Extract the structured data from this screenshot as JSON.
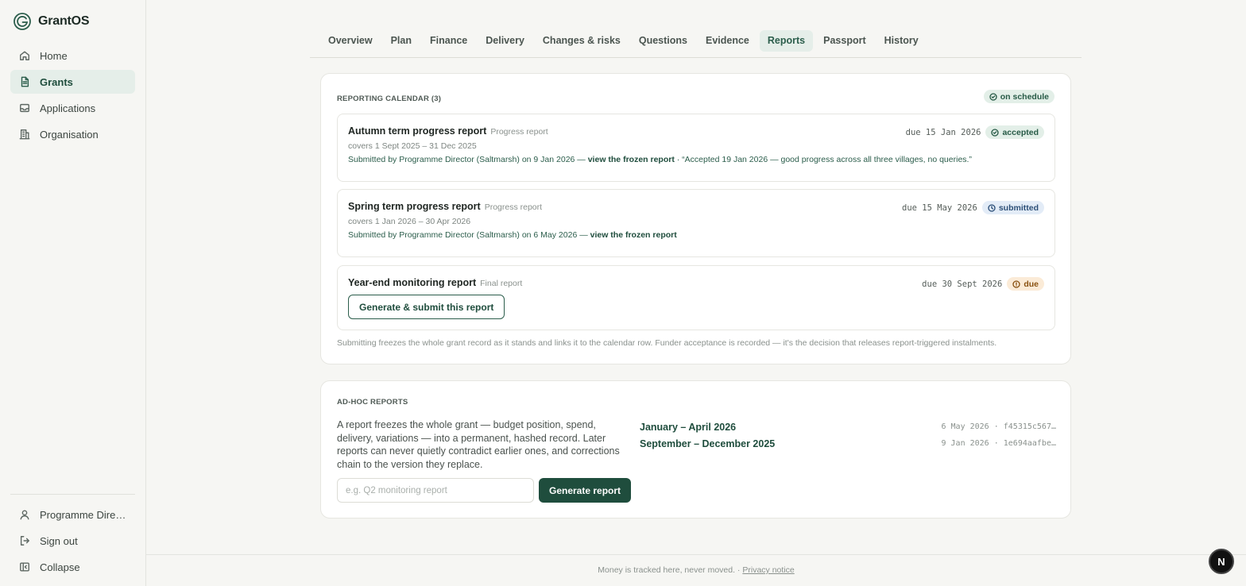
{
  "app": {
    "name": "GrantOS"
  },
  "sidebar": {
    "items": [
      {
        "label": "Home",
        "icon": "home-icon"
      },
      {
        "label": "Grants",
        "icon": "document-icon",
        "active": true
      },
      {
        "label": "Applications",
        "icon": "inbox-icon"
      },
      {
        "label": "Organisation",
        "icon": "building-icon"
      }
    ],
    "bottom": [
      {
        "label": "Programme Direct…",
        "icon": "user-icon"
      },
      {
        "label": "Sign out",
        "icon": "sign-out-icon"
      },
      {
        "label": "Collapse",
        "icon": "sidebar-collapse-icon"
      }
    ]
  },
  "tabs": [
    "Overview",
    "Plan",
    "Finance",
    "Delivery",
    "Changes & risks",
    "Questions",
    "Evidence",
    "Reports",
    "Passport",
    "History"
  ],
  "active_tab": "Reports",
  "calendar": {
    "label": "REPORTING CALENDAR (3)",
    "status": "on schedule",
    "reports": [
      {
        "title": "Autumn term progress report",
        "type": "Progress report",
        "covers": "covers 1 Sept 2025 – 31 Dec 2025",
        "submitted_prefix": "Submitted by Programme Director (Saltmarsh) on 9 Jan 2026 — ",
        "link": "view the frozen report",
        "note": " · “Accepted 19 Jan 2026 — good progress across all three villages, no queries.”",
        "due": "due 15 Jan 2026",
        "status": "accepted"
      },
      {
        "title": "Spring term progress report",
        "type": "Progress report",
        "covers": "covers 1 Jan 2026 – 30 Apr 2026",
        "submitted_prefix": "Submitted by Programme Director (Saltmarsh) on 6 May 2026 — ",
        "link": "view the frozen report",
        "due": "due 15 May 2026",
        "status": "submitted"
      },
      {
        "title": "Year-end monitoring report",
        "type": "Final report",
        "due": "due 30 Sept 2026",
        "status": "due",
        "button": "Generate & submit this report"
      }
    ],
    "footnote": "Submitting freezes the whole grant record as it stands and links it to the calendar row. Funder acceptance is recorded — it's the decision that releases report-triggered instalments."
  },
  "adhoc": {
    "label": "AD-HOC REPORTS",
    "description": "A report freezes the whole grant — budget position, spend, delivery, variations — into a permanent, hashed record. Later reports can never quietly contradict earlier ones, and corrections chain to the version they replace.",
    "input_placeholder": "e.g. Q2 monitoring report",
    "button": "Generate report",
    "reports": [
      {
        "title": "January – April 2026",
        "meta": "6 May 2026 · f45315c567…"
      },
      {
        "title": "September – December 2025",
        "meta": "9 Jan 2026 · 1e694aafbe…"
      }
    ]
  },
  "footer": {
    "text": "Money is tracked here, never moved. · ",
    "link": "Privacy notice"
  },
  "fab": "N"
}
